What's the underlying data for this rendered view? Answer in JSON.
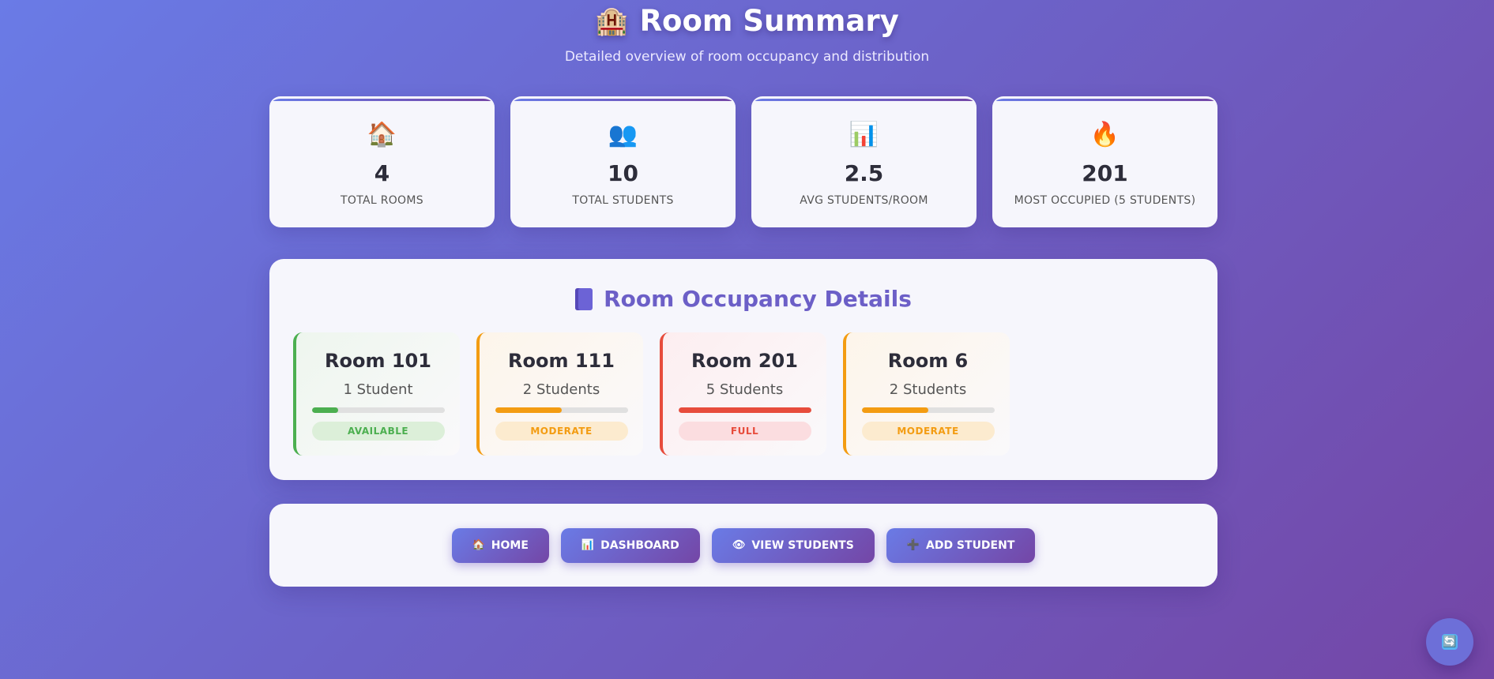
{
  "header": {
    "icon": "🏨",
    "title": "Room Summary",
    "subtitle": "Detailed overview of room occupancy and distribution"
  },
  "stats": [
    {
      "icon": "🏠",
      "icon_name": "house-icon",
      "value": "4",
      "label": "TOTAL ROOMS"
    },
    {
      "icon": "👥",
      "icon_name": "people-icon",
      "value": "10",
      "label": "TOTAL STUDENTS"
    },
    {
      "icon": "📊",
      "icon_name": "bar-chart-icon",
      "value": "2.5",
      "label": "AVG STUDENTS/ROOM"
    },
    {
      "icon": "🔥",
      "icon_name": "fire-icon",
      "value": "201",
      "label": "MOST OCCUPIED (5 STUDENTS)"
    }
  ],
  "details": {
    "title": "Room Occupancy Details",
    "icon_name": "book-icon",
    "rooms": [
      {
        "name": "Room 101",
        "count": "1 Student",
        "occupancy": 0.2,
        "status": "AVAILABLE",
        "color": "#4caf50",
        "badge_bg": "#dcefd9",
        "card_bg": "#eef6ee"
      },
      {
        "name": "Room 111",
        "count": "2 Students",
        "occupancy": 0.5,
        "status": "MODERATE",
        "color": "#f39c12",
        "badge_bg": "#fcebcf",
        "card_bg": "#fdf5ea"
      },
      {
        "name": "Room 201",
        "count": "5 Students",
        "occupancy": 1.0,
        "status": "FULL",
        "color": "#e74c3c",
        "badge_bg": "#fbdde0",
        "card_bg": "#fdeef0"
      },
      {
        "name": "Room 6",
        "count": "2 Students",
        "occupancy": 0.5,
        "status": "MODERATE",
        "color": "#f39c12",
        "badge_bg": "#fcebcf",
        "card_bg": "#fdf5ea"
      }
    ]
  },
  "actions": [
    {
      "icon": "🏠",
      "icon_name": "home-icon",
      "label": "HOME"
    },
    {
      "icon": "📊",
      "icon_name": "dashboard-icon",
      "label": "DASHBOARD"
    },
    {
      "icon": "👁",
      "icon_name": "eye-icon",
      "label": "VIEW STUDENTS"
    },
    {
      "icon": "➕",
      "icon_name": "plus-icon",
      "label": "ADD STUDENT"
    }
  ],
  "fab": {
    "icon": "🔄",
    "icon_name": "refresh-icon"
  }
}
